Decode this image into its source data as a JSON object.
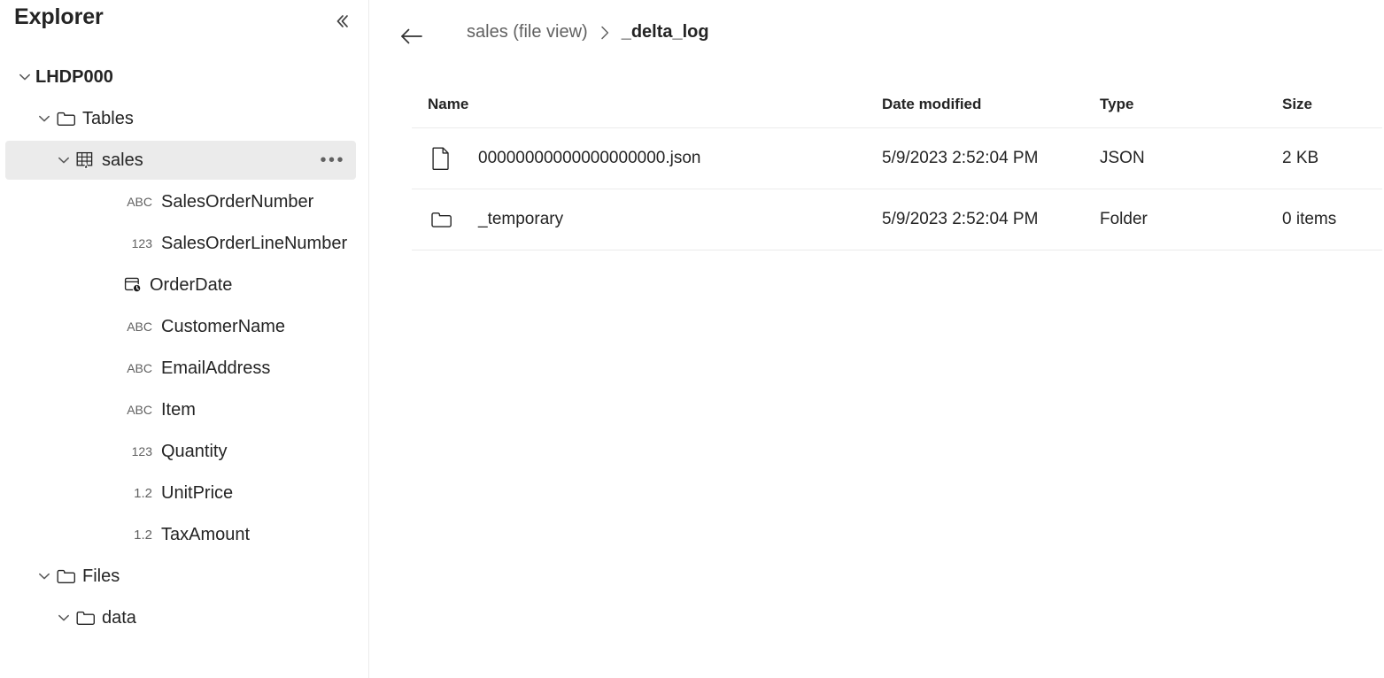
{
  "sidebar": {
    "title": "Explorer",
    "collapse_icon": "chevron-double-left-icon",
    "tree": [
      {
        "label": "LHDP000",
        "icon": "none",
        "type_icon": "",
        "indent": 0,
        "chevron": "expanded",
        "bold": true,
        "selected": false,
        "has_ellipsis": false
      },
      {
        "label": "Tables",
        "icon": "folder-icon",
        "type_icon": "",
        "indent": 1,
        "chevron": "expanded",
        "bold": false,
        "selected": false,
        "has_ellipsis": false
      },
      {
        "label": "sales",
        "icon": "delta-table-icon",
        "type_icon": "",
        "indent": 2,
        "chevron": "expanded",
        "bold": false,
        "selected": true,
        "has_ellipsis": true
      },
      {
        "label": "SalesOrderNumber",
        "icon": "none",
        "type_icon": "ABC",
        "indent": 3,
        "chevron": "none",
        "bold": false,
        "selected": false,
        "has_ellipsis": false
      },
      {
        "label": "SalesOrderLineNumber",
        "icon": "none",
        "type_icon": "123",
        "indent": 3,
        "chevron": "none",
        "bold": false,
        "selected": false,
        "has_ellipsis": false
      },
      {
        "label": "OrderDate",
        "icon": "date-time-icon",
        "type_icon": "",
        "indent": 3,
        "chevron": "none",
        "bold": false,
        "selected": false,
        "has_ellipsis": false
      },
      {
        "label": "CustomerName",
        "icon": "none",
        "type_icon": "ABC",
        "indent": 3,
        "chevron": "none",
        "bold": false,
        "selected": false,
        "has_ellipsis": false
      },
      {
        "label": "EmailAddress",
        "icon": "none",
        "type_icon": "ABC",
        "indent": 3,
        "chevron": "none",
        "bold": false,
        "selected": false,
        "has_ellipsis": false
      },
      {
        "label": "Item",
        "icon": "none",
        "type_icon": "ABC",
        "indent": 3,
        "chevron": "none",
        "bold": false,
        "selected": false,
        "has_ellipsis": false
      },
      {
        "label": "Quantity",
        "icon": "none",
        "type_icon": "123",
        "indent": 3,
        "chevron": "none",
        "bold": false,
        "selected": false,
        "has_ellipsis": false
      },
      {
        "label": "UnitPrice",
        "icon": "none",
        "type_icon": "1.2",
        "indent": 3,
        "chevron": "none",
        "bold": false,
        "selected": false,
        "has_ellipsis": false
      },
      {
        "label": "TaxAmount",
        "icon": "none",
        "type_icon": "1.2",
        "indent": 3,
        "chevron": "none",
        "bold": false,
        "selected": false,
        "has_ellipsis": false
      },
      {
        "label": "Files",
        "icon": "folder-icon",
        "type_icon": "",
        "indent": 1,
        "chevron": "expanded",
        "bold": false,
        "selected": false,
        "has_ellipsis": false
      },
      {
        "label": "data",
        "icon": "folder-icon",
        "type_icon": "",
        "indent": 2,
        "chevron": "expanded",
        "bold": false,
        "selected": false,
        "has_ellipsis": false
      }
    ],
    "row_ellipsis_label": "•••"
  },
  "main": {
    "back_icon": "arrow-left-icon",
    "breadcrumb": [
      {
        "label": "sales (file view)",
        "current": false
      },
      {
        "label": "_delta_log",
        "current": true
      }
    ],
    "table": {
      "columns": [
        "Name",
        "Date modified",
        "Type",
        "Size"
      ],
      "rows": [
        {
          "icon": "file-json-icon",
          "name": "00000000000000000000.json",
          "date_modified": "5/9/2023 2:52:04 PM",
          "type": "JSON",
          "size": "2 KB"
        },
        {
          "icon": "folder-icon",
          "name": "_temporary",
          "date_modified": "5/9/2023 2:52:04 PM",
          "type": "Folder",
          "size": "0 items"
        }
      ]
    }
  },
  "colors": {
    "background": "#ffffff",
    "text_primary": "#242424",
    "text_secondary": "#616161",
    "divider": "#ebebeb",
    "row_selected": "#ebebeb"
  }
}
